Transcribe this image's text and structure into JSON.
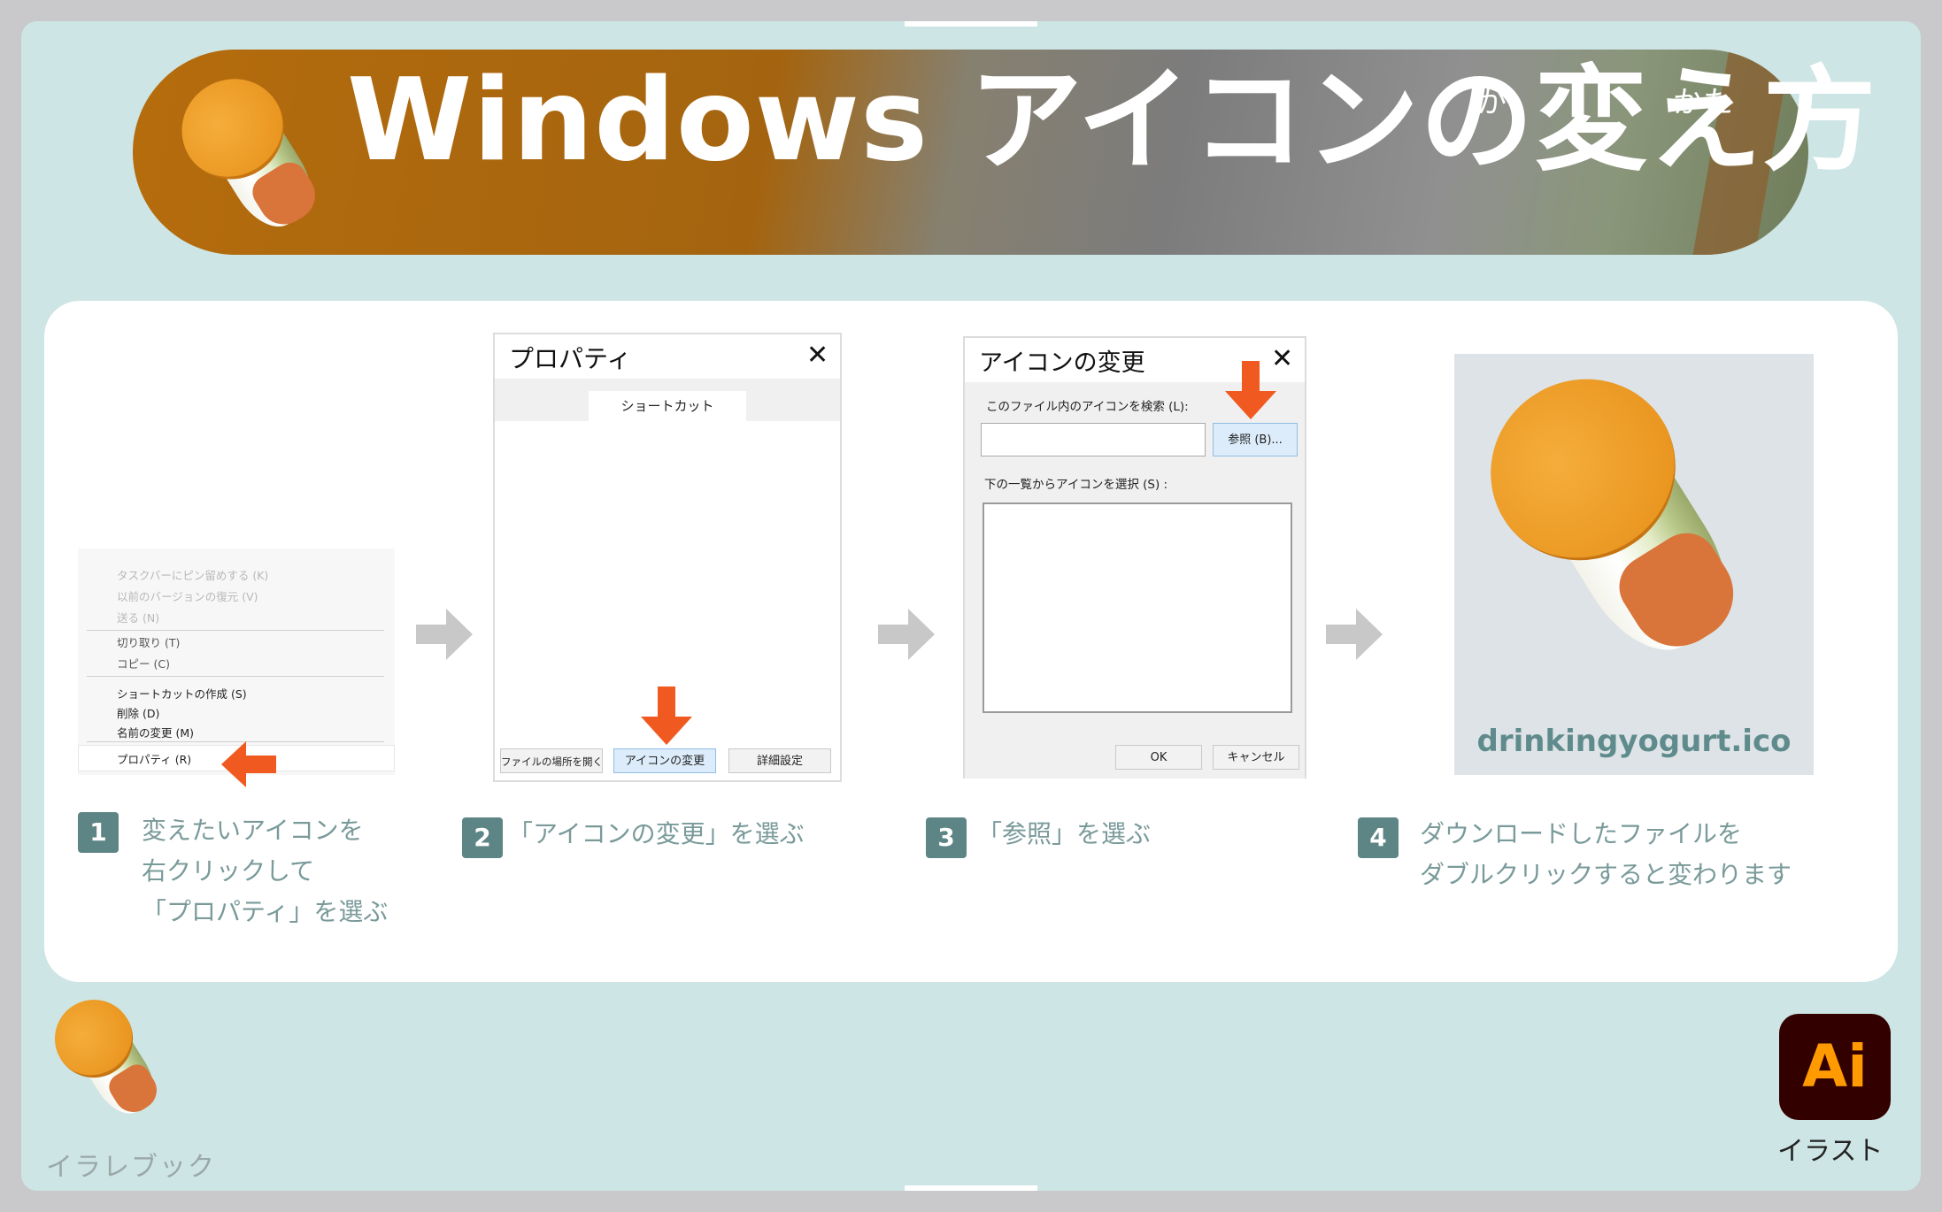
{
  "banner": {
    "title": "Windows アイコンの変え方",
    "ruby_ka": "か",
    "ruby_kata": "かた"
  },
  "step1": {
    "menu_items": [
      "タスクバーにピン留めする (K)",
      "以前のバージョンの復元 (V)",
      "送る (N)",
      "切り取り (T)",
      "コピー (C)",
      "ショートカットの作成 (S)",
      "削除 (D)",
      "名前の変更 (M)",
      "プロパティ (R)"
    ],
    "caption": "変えたいアイコンを\n右クリックして\n「プロパティ」を選ぶ",
    "number": "1"
  },
  "step2": {
    "dialog_title": "プロパティ",
    "tab": "ショートカット",
    "buttons": [
      "ファイルの場所を開く",
      "アイコンの変更",
      "詳細設定"
    ],
    "caption": "「アイコンの変更」を選ぶ",
    "number": "2"
  },
  "step3": {
    "dialog_title": "アイコンの変更",
    "search_label": "このファイル内のアイコンを検索 (L):",
    "browse_button": "参照 (B)...",
    "list_label": "下の一覧からアイコンを選択 (S) :",
    "ok": "OK",
    "cancel": "キャンセル",
    "caption": "「参照」を選ぶ",
    "number": "3"
  },
  "step4": {
    "filename": "drinkingyogurt.ico",
    "caption": "ダウンロードしたファイルを\nダブルクリックすると変わります",
    "number": "4"
  },
  "footer": {
    "brand": "イラレブック",
    "ai_text": "Ai",
    "ai_label": "イラスト"
  },
  "icons": {
    "close": "✕"
  },
  "colors": {
    "accent_orange": "#f0591f",
    "arrow_gray": "#c8c8c8",
    "step_badge": "#5e8585"
  }
}
